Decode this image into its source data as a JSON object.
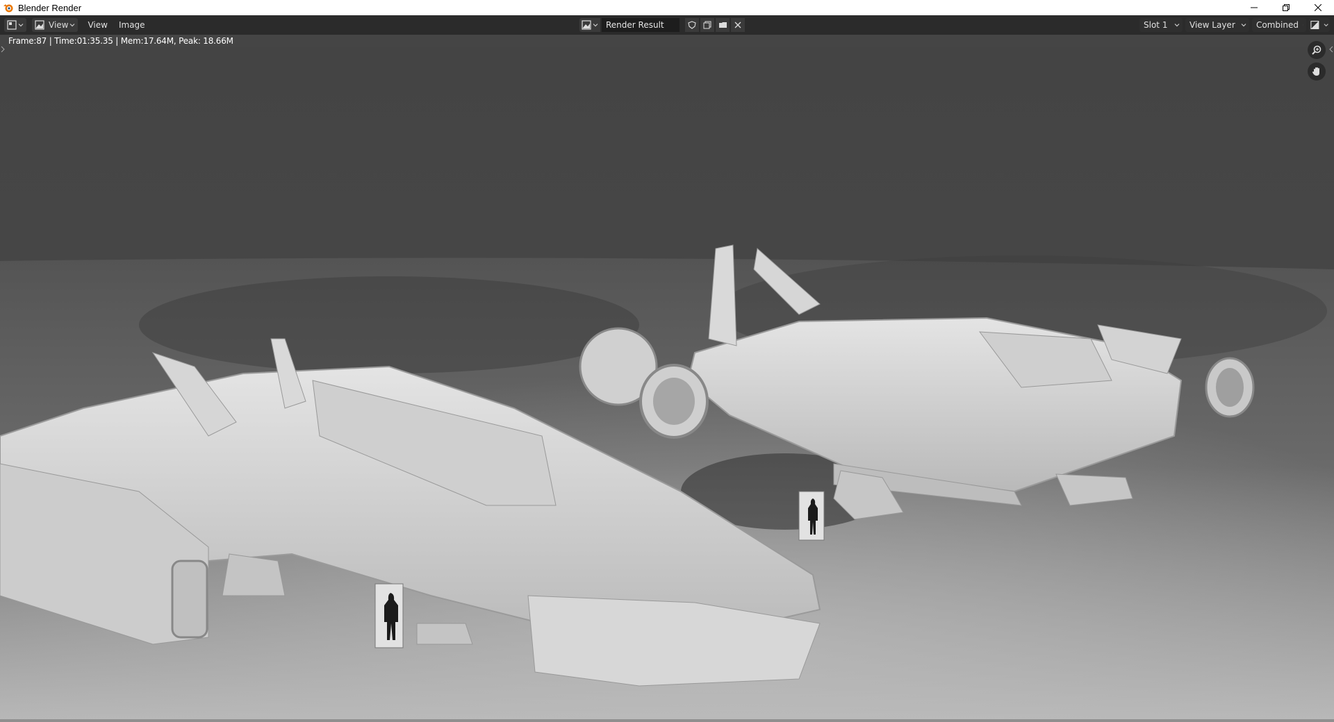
{
  "window": {
    "title": "Blender Render",
    "controls": [
      "minimize-icon",
      "restore-icon",
      "close-icon"
    ]
  },
  "header": {
    "editor_type_icon": "image-editor-icon",
    "mode_icon": "image-mode-icon",
    "mode_label": "View",
    "menus": [
      "View",
      "Image"
    ],
    "image_browse_icon": "image-browse-icon",
    "image_name": "Render Result",
    "image_buttons": [
      "fake-user-shield-icon",
      "new-image-icon",
      "open-folder-icon",
      "unlink-x-icon"
    ],
    "slot": "Slot 1",
    "view_layer": "View Layer",
    "render_pass": "Combined",
    "display_channels_icon": "display-channels-icon"
  },
  "viewport": {
    "stats": "Frame:87 | Time:01:35.35 | Mem:17.64M, Peak: 18.66M",
    "nav_icons": [
      "zoom-icon",
      "hand-pan-icon"
    ]
  },
  "colors": {
    "titlebar_bg": "#ffffff",
    "header_bg": "#2b2b2b",
    "field_bg": "#1d1d1d",
    "render_top": "#444444",
    "render_floor": "#9a9a9a",
    "model": "#d8d8d8"
  }
}
